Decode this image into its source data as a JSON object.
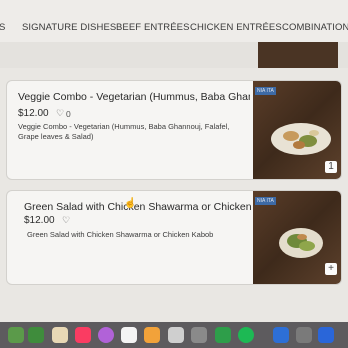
{
  "nav": {
    "items": [
      {
        "label": "S"
      },
      {
        "label": "SIGNATURE DISHES"
      },
      {
        "label": "BEEF ENTRÉES"
      },
      {
        "label": "CHICKEN ENTRÉES"
      },
      {
        "label": "COMBINATION EN"
      }
    ]
  },
  "menu": [
    {
      "title": "Veggie Combo - Vegetarian (Hummus, Baba Ghannouj,...",
      "price": "$12.00",
      "likes": "0",
      "description": "Veggie Combo - Vegetarian (Hummus, Baba Ghannouj, Falafel, Grape leaves & Salad)",
      "badge": "NIA ITA",
      "cart_count": "1"
    },
    {
      "title": "Green Salad with Chicken Shawarma or Chicken Kabob",
      "price": "$12.00",
      "likes": "",
      "description": "Green Salad with Chicken Shawarma or Chicken Kabob",
      "badge": "NIA ITA",
      "add_label": "+"
    }
  ],
  "icons": {
    "heart": "heart-outline-icon",
    "add": "plus-icon",
    "cursor": "hand-cursor-icon"
  }
}
